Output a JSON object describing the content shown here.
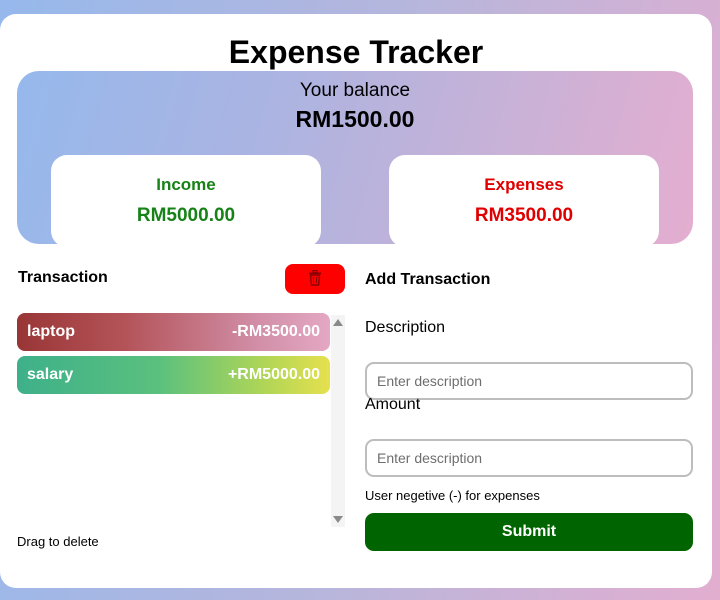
{
  "app": {
    "title": "Expense Tracker"
  },
  "balance": {
    "label": "Your balance",
    "amount": "RM1500.00"
  },
  "income": {
    "label": "Income",
    "amount": "RM5000.00"
  },
  "expenses": {
    "label": "Expenses",
    "amount": "RM3500.00"
  },
  "transactions": {
    "heading": "Transaction",
    "delete_icon": "trash-icon",
    "items": [
      {
        "name": "laptop",
        "amount": "-RM3500.00"
      },
      {
        "name": "salary",
        "amount": "+RM5000.00"
      }
    ],
    "drag_hint": "Drag to delete"
  },
  "add_form": {
    "heading": "Add Transaction",
    "description_label": "Description",
    "description_placeholder": "Enter description",
    "amount_label": "Amount",
    "amount_placeholder": "Enter description",
    "hint": "User negetive (-) for expenses",
    "submit_label": "Submit"
  },
  "colors": {
    "income": "#178217",
    "expense": "#e00000",
    "delete_button": "#ff0000",
    "submit_button": "#006400"
  }
}
